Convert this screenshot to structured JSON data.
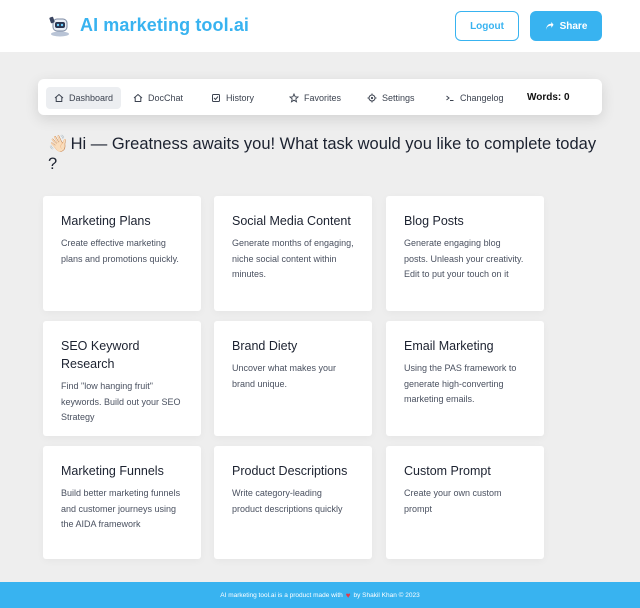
{
  "header": {
    "brand": "AI marketing tool.ai",
    "logout_label": "Logout",
    "share_label": "Share"
  },
  "nav": {
    "items": [
      {
        "label": "Dashboard",
        "icon": "home-icon"
      },
      {
        "label": "DocChat",
        "icon": "home-icon"
      },
      {
        "label": "History",
        "icon": "history-icon"
      },
      {
        "label": "Favorites",
        "icon": "star-icon"
      },
      {
        "label": "Settings",
        "icon": "gear-icon"
      },
      {
        "label": "Changelog",
        "icon": "terminal-icon"
      }
    ],
    "words": "Words: 0"
  },
  "greeting": {
    "emoji": "👋🏻",
    "text": "Hi — Greatness awaits you! What task would you like to complete today ?"
  },
  "cards": [
    {
      "title": "Marketing Plans",
      "desc": "Create effective marketing plans and promotions quickly."
    },
    {
      "title": "Social Media Content",
      "desc": "Generate months of engaging, niche social content within minutes."
    },
    {
      "title": "Blog Posts",
      "desc": "Generate engaging blog posts. Unleash your creativity. Edit to put your touch on it"
    },
    {
      "title": "SEO Keyword Research",
      "desc": "Find \"low hanging fruit\" keywords. Build out your SEO Strategy"
    },
    {
      "title": "Brand Diety",
      "desc": "Uncover what makes your brand unique."
    },
    {
      "title": "Email Marketing",
      "desc": "Using the PAS framework to generate high-converting marketing emails."
    },
    {
      "title": "Marketing Funnels",
      "desc": "Build better marketing funnels and customer journeys using the AIDA framework"
    },
    {
      "title": "Product Descriptions",
      "desc": "Write category-leading product descriptions quickly"
    },
    {
      "title": "Custom Prompt",
      "desc": "Create your own custom prompt"
    }
  ],
  "footer": {
    "prefix": "AI marketing tool.ai is a product made with",
    "heart": "♥",
    "suffix": "by Shakil Khan © 2023"
  },
  "colors": {
    "accent": "#38b3f0",
    "background": "#eeeeee",
    "card": "#ffffff"
  }
}
